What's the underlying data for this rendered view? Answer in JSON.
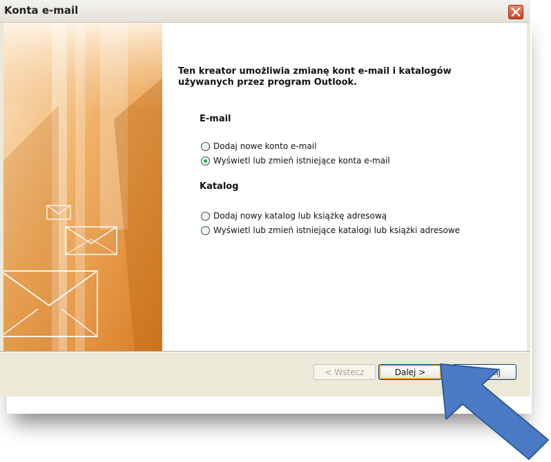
{
  "window": {
    "title": "Konta e-mail",
    "close_icon": "close-x-icon"
  },
  "main": {
    "heading": "Ten kreator umożliwia zmianę kont e-mail i katalogów używanych przez program Outlook.",
    "sections": [
      {
        "title": "E-mail",
        "options": [
          {
            "label": "Dodaj nowe konto e-mail",
            "checked": false
          },
          {
            "label": "Wyświetl lub zmień istniejące konta e-mail",
            "checked": true
          }
        ]
      },
      {
        "title": "Katalog",
        "options": [
          {
            "label": "Dodaj nowy katalog lub książkę adresową",
            "checked": false
          },
          {
            "label": "Wyświetl lub zmień istniejące katalogi lub książki adresowe",
            "checked": false
          }
        ]
      }
    ]
  },
  "buttons": {
    "back": "< Wstecz",
    "next": "Dalej >",
    "close": "mknij"
  },
  "colors": {
    "accent_arrow": "#4a7bc4",
    "art_orange": "#e8a04c",
    "selected_radio": "#2aa43a"
  }
}
